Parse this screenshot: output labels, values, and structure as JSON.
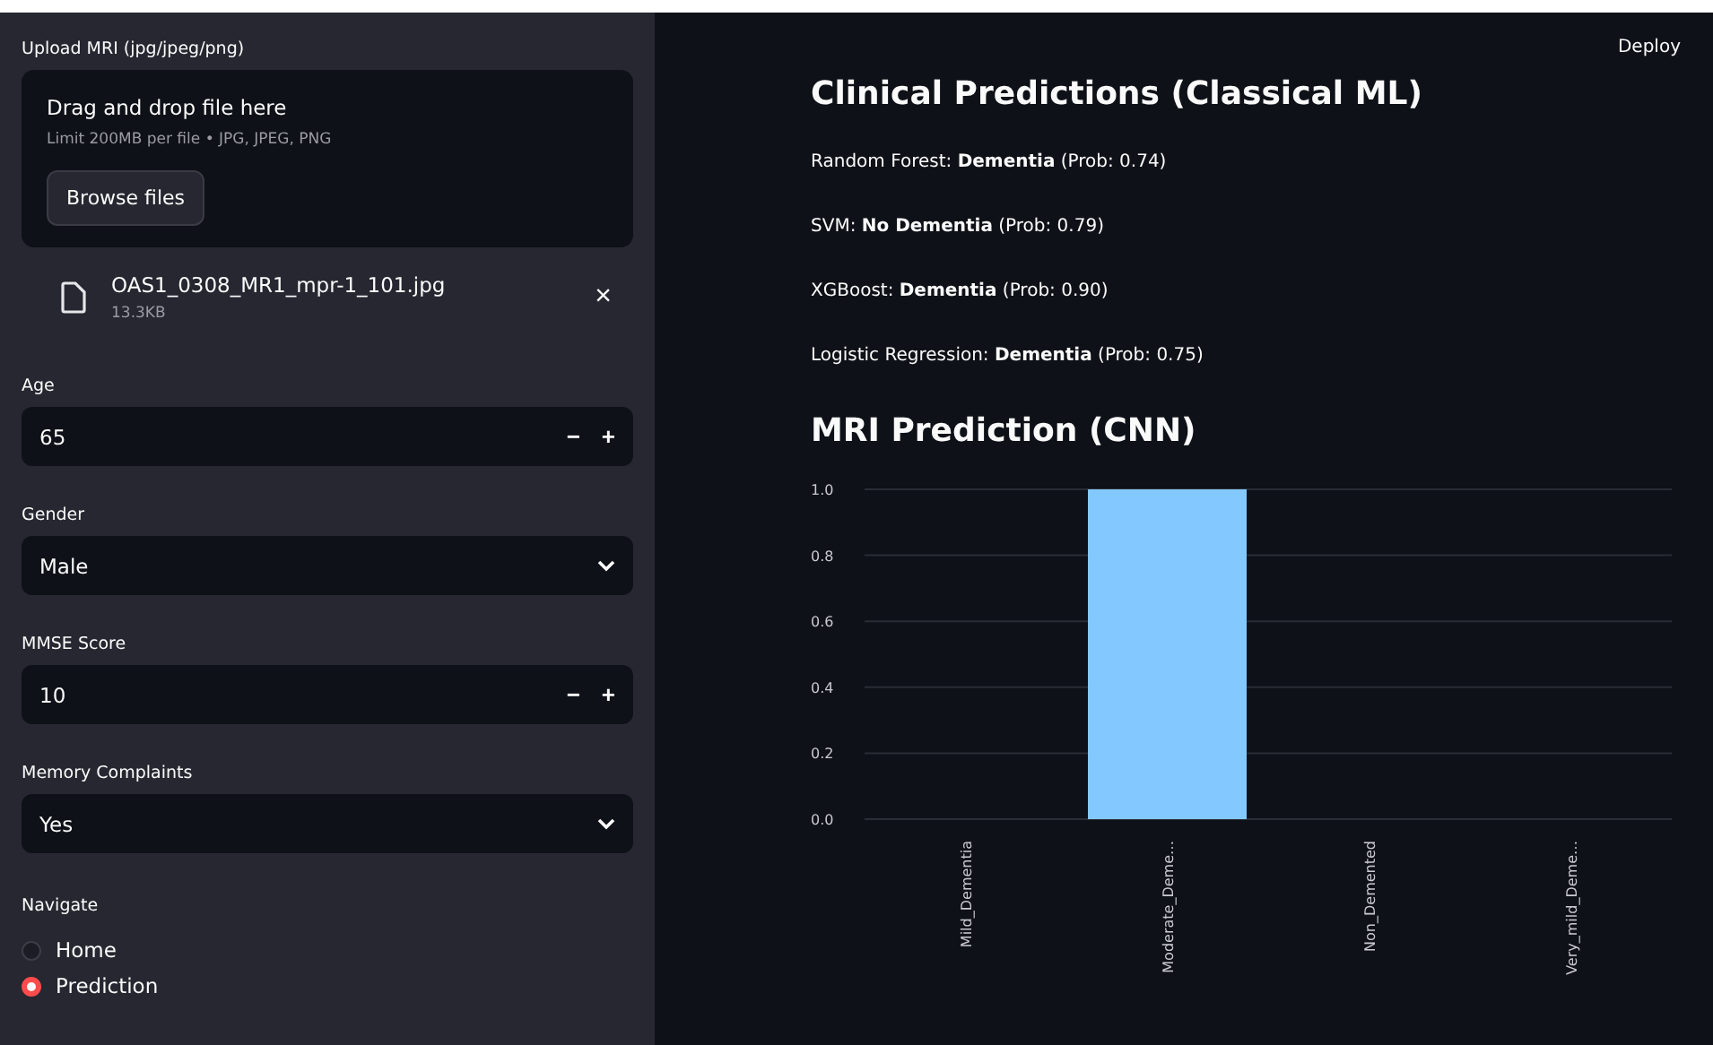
{
  "deploy": "Deploy",
  "uploader": {
    "label": "Upload MRI (jpg/jpeg/png)",
    "drop_text": "Drag and drop file here",
    "limit": "Limit 200MB per file • JPG, JPEG, PNG",
    "button": "Browse files",
    "file": {
      "name": "OAS1_0308_MR1_mpr-1_101.jpg",
      "size": "13.3KB",
      "remove": "×"
    }
  },
  "fields": [
    {
      "kind": "number",
      "label": "Age",
      "value": "65",
      "minus": "−",
      "plus": "+"
    },
    {
      "kind": "select",
      "label": "Gender",
      "value": "Male"
    },
    {
      "kind": "number",
      "label": "MMSE Score",
      "value": "10",
      "minus": "−",
      "plus": "+"
    },
    {
      "kind": "select",
      "label": "Memory Complaints",
      "value": "Yes"
    }
  ],
  "navigate": {
    "label": "Navigate",
    "options": [
      {
        "label": "Home",
        "selected": false
      },
      {
        "label": "Prediction",
        "selected": true
      }
    ]
  },
  "clinical": {
    "title": "Clinical Predictions (Classical ML)",
    "lines": [
      "Random Forest: **Dementia** (Prob: 0.74)",
      "SVM: **No Dementia** (Prob: 0.79)",
      "XGBoost: **Dementia** (Prob: 0.90)",
      "Logistic Regression: **Dementia** (Prob: 0.75)"
    ]
  },
  "mri": {
    "title": "MRI Prediction (CNN)",
    "chart_data": {
      "type": "bar",
      "categories": [
        "Mild_Dementia",
        "Moderate_Deme…",
        "Non_Demented",
        "Very_mild_Deme…"
      ],
      "series": [
        {
          "color": "#83c9ff",
          "values": [
            0,
            1,
            0,
            0
          ]
        }
      ],
      "grid": true,
      "ylim": [
        0,
        1
      ],
      "yticks": [
        {
          "value": 0,
          "label": "0.0"
        },
        {
          "value": 0.2,
          "label": "0.2"
        },
        {
          "value": 0.4,
          "label": "0.4"
        },
        {
          "value": 0.6,
          "label": "0.6"
        },
        {
          "value": 0.8,
          "label": "0.8"
        },
        {
          "value": 1,
          "label": "1.0"
        }
      ]
    }
  }
}
